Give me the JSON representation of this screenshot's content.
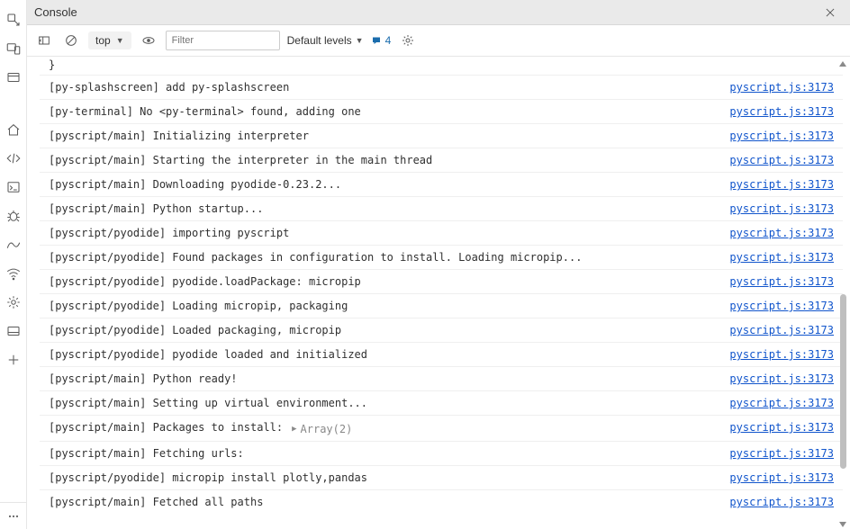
{
  "header": {
    "title": "Console"
  },
  "toolbar": {
    "context_label": "top",
    "filter_placeholder": "Filter",
    "levels_label": "Default levels",
    "issues_count": "4"
  },
  "preamble": "}",
  "array_preview_label": "Array(2)",
  "logs": [
    {
      "msg": "[py-splashscreen] add py-splashscreen",
      "src": "pyscript.js:3173"
    },
    {
      "msg": "[py-terminal] No <py-terminal> found, adding one",
      "src": "pyscript.js:3173"
    },
    {
      "msg": "[pyscript/main] Initializing interpreter",
      "src": "pyscript.js:3173"
    },
    {
      "msg": "[pyscript/main] Starting the interpreter in the main thread",
      "src": "pyscript.js:3173"
    },
    {
      "msg": "[pyscript/main] Downloading pyodide-0.23.2...",
      "src": "pyscript.js:3173"
    },
    {
      "msg": "[pyscript/main] Python startup...",
      "src": "pyscript.js:3173"
    },
    {
      "msg": "[pyscript/pyodide] importing pyscript",
      "src": "pyscript.js:3173"
    },
    {
      "msg": "[pyscript/pyodide] Found packages in configuration to install. Loading micropip...",
      "src": "pyscript.js:3173"
    },
    {
      "msg": "[pyscript/pyodide] pyodide.loadPackage: micropip",
      "src": "pyscript.js:3173"
    },
    {
      "msg": "[pyscript/pyodide] Loading micropip, packaging",
      "src": "pyscript.js:3173"
    },
    {
      "msg": "[pyscript/pyodide] Loaded packaging, micropip",
      "src": "pyscript.js:3173"
    },
    {
      "msg": "[pyscript/pyodide] pyodide loaded and initialized",
      "src": "pyscript.js:3173"
    },
    {
      "msg": "[pyscript/main] Python ready!",
      "src": "pyscript.js:3173"
    },
    {
      "msg": "[pyscript/main] Setting up virtual environment...",
      "src": "pyscript.js:3173"
    },
    {
      "msg": "[pyscript/main] Packages to install:",
      "src": "pyscript.js:3173",
      "has_array": true
    },
    {
      "msg": "[pyscript/main] Fetching urls:",
      "src": "pyscript.js:3173"
    },
    {
      "msg": "[pyscript/pyodide] micropip install plotly,pandas",
      "src": "pyscript.js:3173"
    },
    {
      "msg": "[pyscript/main] Fetched all paths",
      "src": "pyscript.js:3173"
    }
  ]
}
